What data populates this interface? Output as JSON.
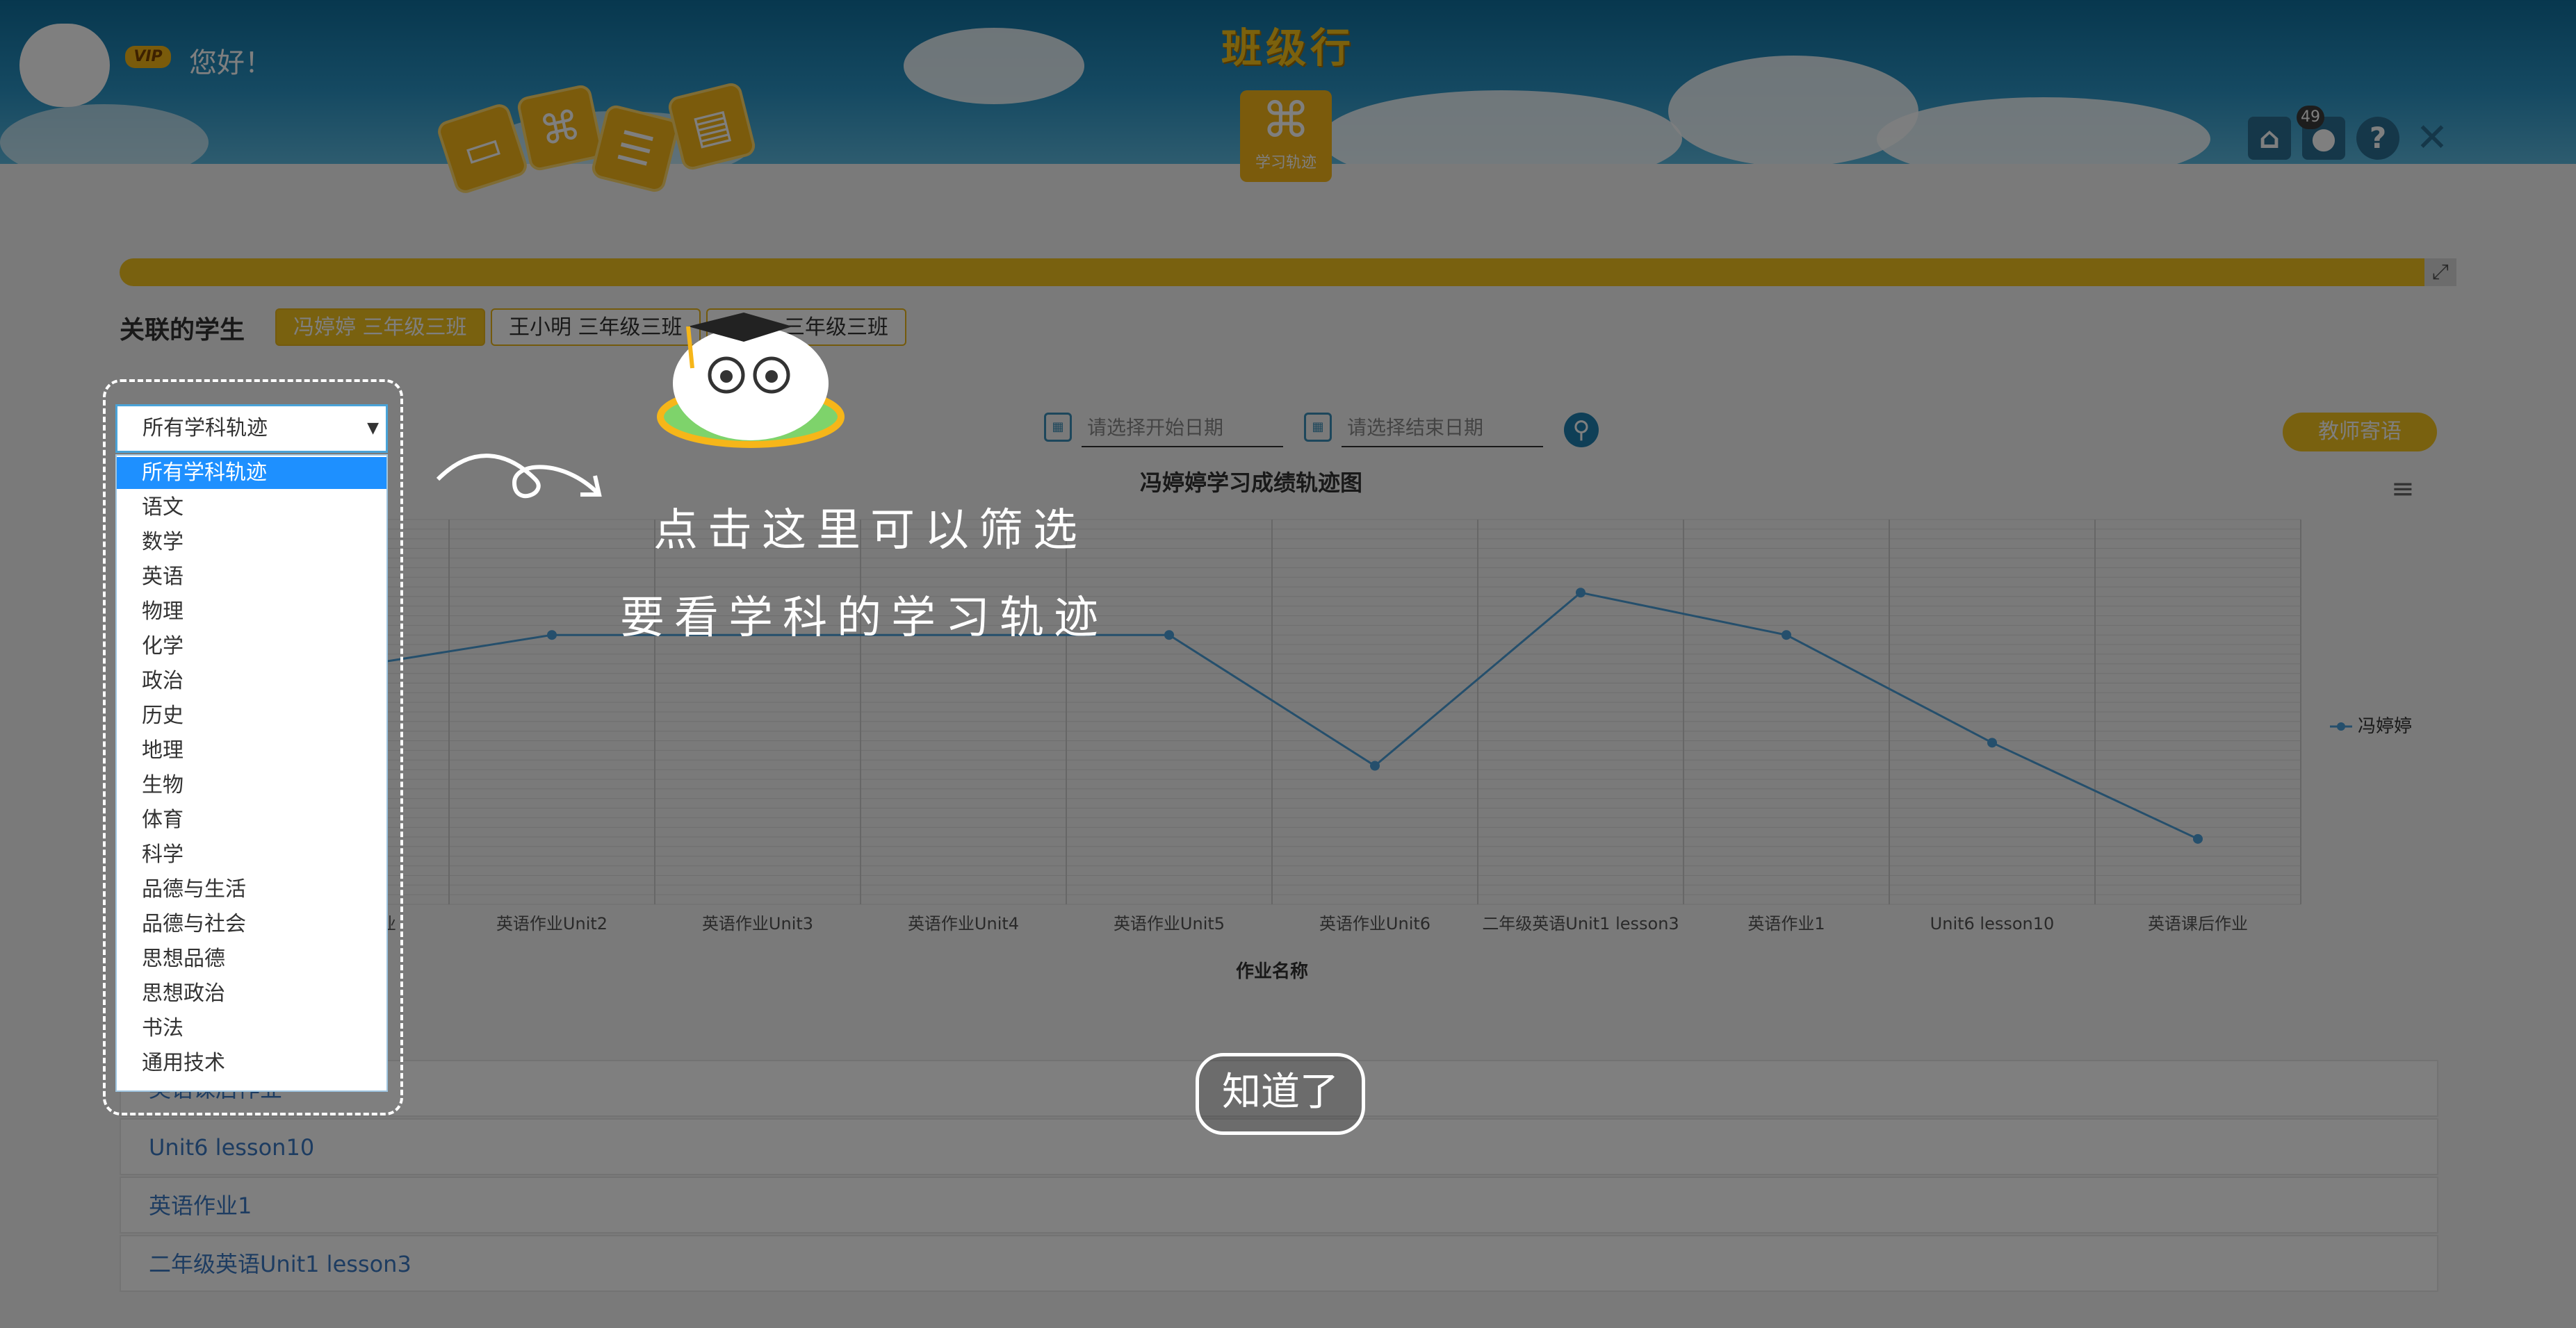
{
  "header": {
    "title": "班级行",
    "vip_label": "VIP",
    "greeting": "您好！",
    "center_tile_label": "学习轨迹",
    "center_tile_icon": "command-icon",
    "app_tiles": [
      "photo-icon",
      "command-icon",
      "books-icon",
      "report-icon"
    ],
    "badge_count": "49",
    "icons": [
      "home-icon",
      "user-icon",
      "help-icon",
      "close-icon"
    ]
  },
  "students": {
    "label": "关联的学生",
    "chips": [
      "冯婷婷 三年级三班",
      "王小明 三年级三班",
      "三年级三班"
    ]
  },
  "filters": {
    "subject_selected": "所有学科轨迹",
    "start_placeholder": "请选择开始日期",
    "end_placeholder": "请选择结束日期",
    "teacher_button": "教师寄语"
  },
  "chart_data": {
    "type": "line",
    "title": "冯婷婷学习成绩轨迹图",
    "xlabel": "作业名称",
    "categories": [
      "英语课后作业",
      "英语作业Unit2",
      "英语作业Unit3",
      "英语作业Unit4",
      "英语作业Unit5",
      "英语作业Unit6",
      "二年级英语Unit1 lesson3",
      "英语作业1",
      "Unit6 lesson10",
      "英语课后作业"
    ],
    "series": [
      {
        "name": "冯婷婷",
        "values": [
          null,
          70,
          null,
          null,
          70,
          36,
          81,
          70,
          42,
          17
        ]
      }
    ],
    "ylim": [
      0,
      100
    ],
    "grid": true,
    "legend": "right",
    "line_color": "#4a9fd8"
  },
  "list": {
    "rows": [
      "英语课后作业",
      "Unit6 lesson10",
      "英语作业1",
      "二年级英语Unit1 lesson3"
    ]
  },
  "overlay": {
    "dropdown_options": [
      "所有学科轨迹",
      "语文",
      "数学",
      "英语",
      "物理",
      "化学",
      "政治",
      "历史",
      "地理",
      "生物",
      "体育",
      "科学",
      "品德与生活",
      "品德与社会",
      "思想品德",
      "思想政治",
      "书法",
      "通用技术"
    ],
    "tip_line1": "点击这里可以筛选",
    "tip_line2": "要看学科的学习轨迹",
    "ok_button": "知道了"
  }
}
